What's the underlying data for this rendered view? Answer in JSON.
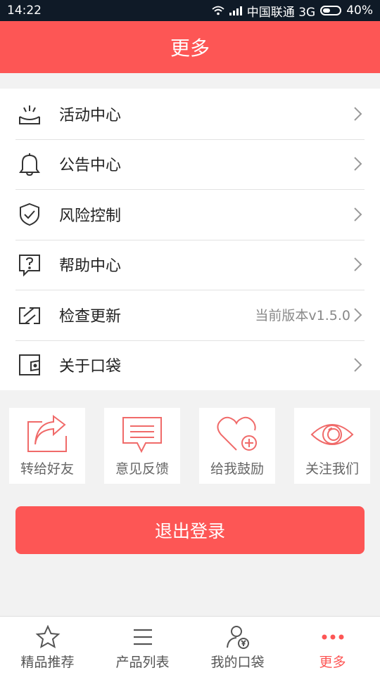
{
  "statusbar": {
    "time": "14:22",
    "carrier": "中国联通 3G",
    "battery": "40%"
  },
  "header": {
    "title": "更多"
  },
  "menu": [
    {
      "label": "活动中心",
      "icon": "activity-icon",
      "extra": ""
    },
    {
      "label": "公告中心",
      "icon": "bell-icon",
      "extra": ""
    },
    {
      "label": "风险控制",
      "icon": "shield-check-icon",
      "extra": ""
    },
    {
      "label": "帮助中心",
      "icon": "help-question-icon",
      "extra": ""
    },
    {
      "label": "检查更新",
      "icon": "refresh-icon",
      "extra": "当前版本v1.5.0"
    },
    {
      "label": "关于口袋",
      "icon": "wallet-icon",
      "extra": ""
    }
  ],
  "tiles": [
    {
      "label": "转给好友",
      "icon": "share-icon"
    },
    {
      "label": "意见反馈",
      "icon": "feedback-icon"
    },
    {
      "label": "给我鼓励",
      "icon": "heart-plus-icon"
    },
    {
      "label": "关注我们",
      "icon": "eye-icon"
    }
  ],
  "logout": {
    "label": "退出登录"
  },
  "tabs": [
    {
      "label": "精品推荐",
      "icon": "star-icon"
    },
    {
      "label": "产品列表",
      "icon": "list-icon"
    },
    {
      "label": "我的口袋",
      "icon": "user-money-icon"
    },
    {
      "label": "更多",
      "icon": "more-dots-icon",
      "active": true
    }
  ],
  "colors": {
    "accent": "#fd5655",
    "statusbar": "#0f1a27",
    "background": "#f2f2f2"
  }
}
